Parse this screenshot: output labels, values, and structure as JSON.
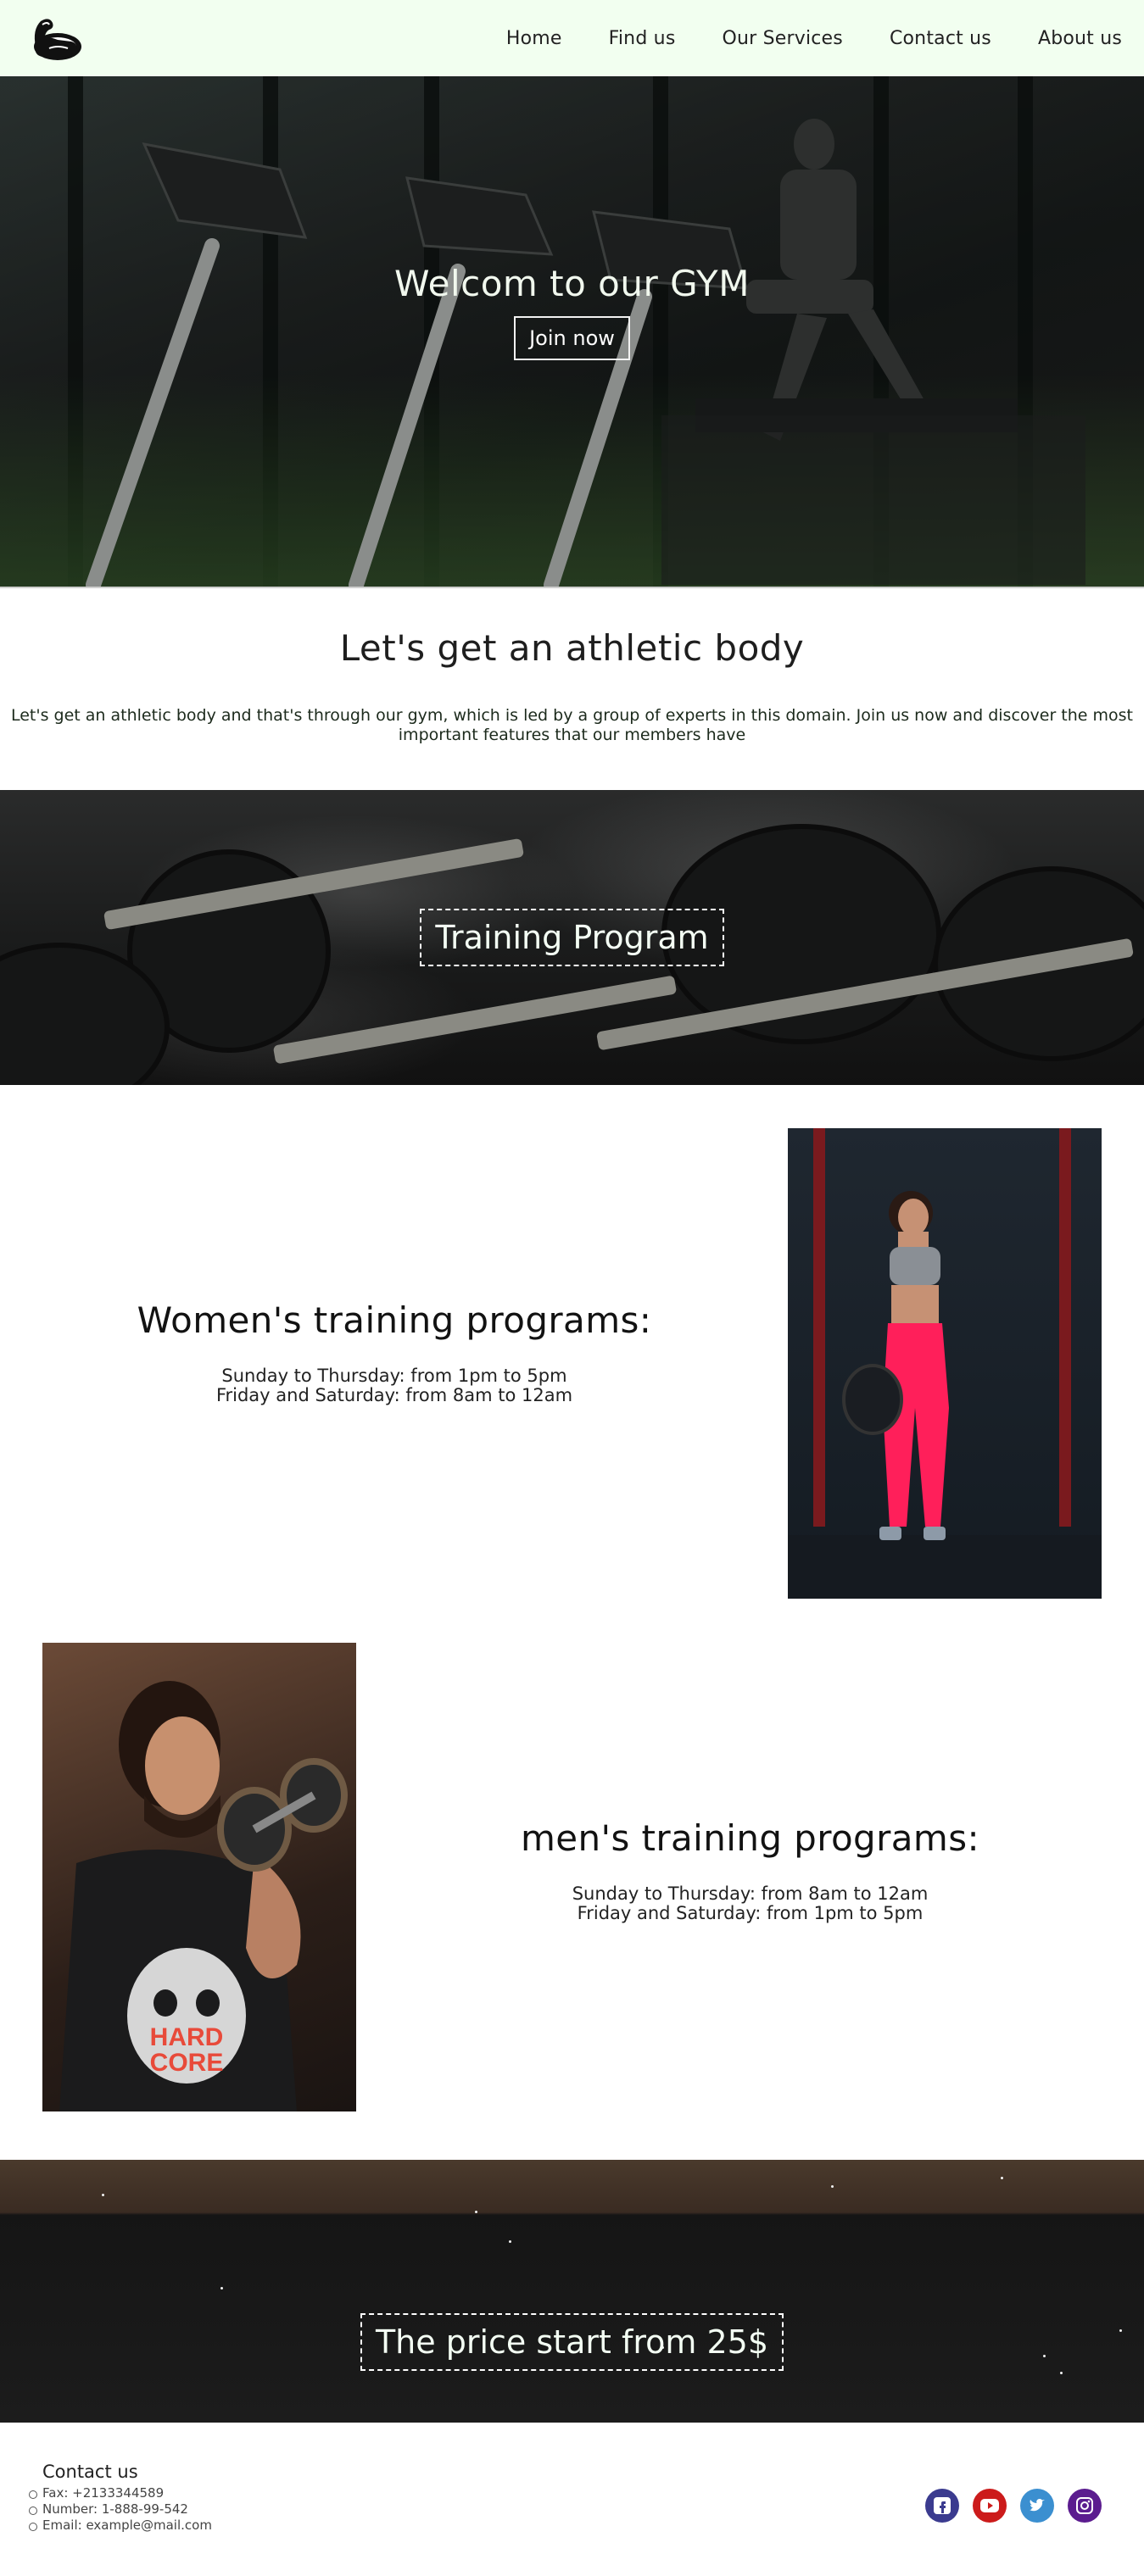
{
  "nav": {
    "links": [
      "Home",
      "Find us",
      "Our Services",
      "Contact us",
      "About us"
    ]
  },
  "hero": {
    "title": "Welcom to our GYM",
    "button": "Join now"
  },
  "athletic": {
    "heading": "Let's get an athletic body",
    "text": "Let's get an athletic body and that's through our gym, which is led by a group of experts in this domain. Join us now and discover the most important features that our members have"
  },
  "training_banner": {
    "label": "Training Program"
  },
  "women": {
    "title": "Women's training programs:",
    "hours": [
      "Sunday to Thursday: from 1pm to 5pm",
      "Friday and Saturday: from 8am to 12am"
    ],
    "photo_label": "woman-weights-photo"
  },
  "men": {
    "title": "men's training programs:",
    "hours": [
      "Sunday to Thursday: from 8am to 12am",
      "Friday and Saturday: from 1pm to 5pm"
    ],
    "photo_label": "man-dumbbell-photo",
    "shirt_text": [
      "HARD",
      "CORE"
    ]
  },
  "price_banner": {
    "label": "The price start from 25$"
  },
  "footer": {
    "contact_title": "Contact us",
    "items": [
      "Fax: +2133344589",
      "Number: 1-888-99-542",
      "Email: example@mail.com"
    ],
    "socials": [
      {
        "name": "facebook-icon",
        "color": "#3b3b8f"
      },
      {
        "name": "youtube-icon",
        "color": "#cc1b1b"
      },
      {
        "name": "twitter-icon",
        "color": "#3b8fd0"
      },
      {
        "name": "instagram-icon",
        "color": "#5b1c8f"
      }
    ]
  },
  "colors": {
    "nav_bg": "#f2fff0",
    "hero_text": "#f1f8ee"
  }
}
